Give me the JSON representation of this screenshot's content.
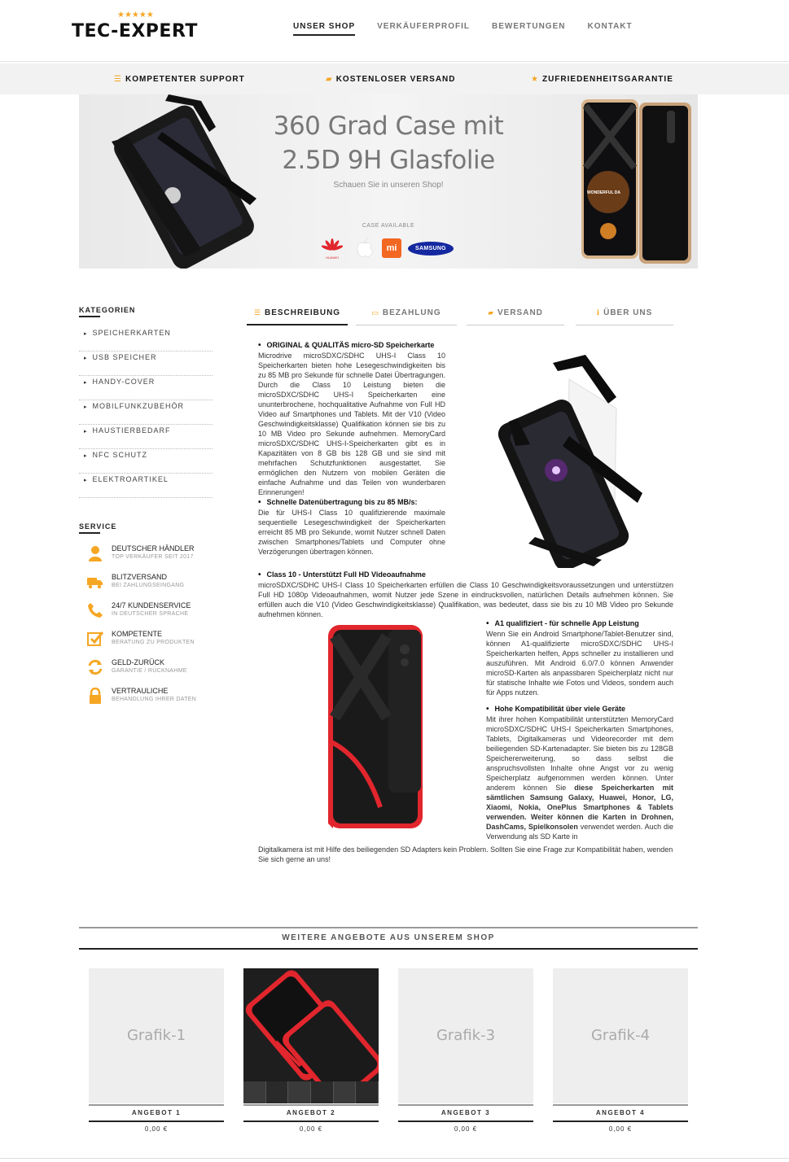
{
  "header": {
    "logo_stars": "★★★★★",
    "logo_text": "TEC-EXPERT",
    "nav": [
      "UNSER SHOP",
      "VERKÄUFERPROFIL",
      "BEWERTUNGEN",
      "KONTAKT"
    ]
  },
  "usp": [
    {
      "icon": "list-icon",
      "glyph": "☰",
      "label": "KOMPETENTER SUPPORT"
    },
    {
      "icon": "truck-icon",
      "glyph": "▰",
      "label": "KOSTENLOSER VERSAND"
    },
    {
      "icon": "star-icon",
      "glyph": "★",
      "label": "ZUFRIEDENHEITSGARANTIE"
    }
  ],
  "banner": {
    "title_line1": "360 Grad Case mit",
    "title_line2": "2.5D 9H Glasfolie",
    "subtitle": "Schauen Sie in unseren Shop!",
    "case_available": "CASE AVAILABLE",
    "brand_huawei": "HUAWEI",
    "brand_mi": "mi",
    "brand_samsung": "SAMSUNG"
  },
  "sidebar": {
    "categories_title": "KATEGORIEN",
    "categories": [
      "SPEICHERKARTEN",
      "USB SPEICHER",
      "HANDY-COVER",
      "MOBILFUNKZUBEHÖR",
      "HAUSTIERBEDARF",
      "NFC SCHUTZ",
      "ELEKTROARTIKEL"
    ],
    "service_title": "SERVICE",
    "services": [
      {
        "icon": "user-icon",
        "title": "DEUTSCHER HÄNDLER",
        "sub": "TOP VERKÄUFER SEIT 2017"
      },
      {
        "icon": "truck-icon",
        "title": "BLITZVERSAND",
        "sub": "BEI ZAHLUNGSEINGANG"
      },
      {
        "icon": "phone-icon",
        "title": "24/7 KUNDENSERVICE",
        "sub": "IN DEUTSCHER SPRACHE"
      },
      {
        "icon": "checkbox-icon",
        "title": "KOMPETENTE",
        "sub": "BERATUNG ZU PRODUKTEN"
      },
      {
        "icon": "refresh-icon",
        "title": "GELD-ZURÜCK",
        "sub": "GARANTIE / RÜCKNAHME"
      },
      {
        "icon": "lock-icon",
        "title": "VERTRAULICHE",
        "sub": "BEHANDLUNG IHRER DATEN"
      }
    ]
  },
  "tabs": [
    {
      "glyph": "☰",
      "label": "BESCHREIBUNG"
    },
    {
      "glyph": "▭",
      "label": "BEZAHLUNG"
    },
    {
      "glyph": "▰",
      "label": "VERSAND"
    },
    {
      "glyph": "ℹ",
      "label": "ÜBER UNS"
    }
  ],
  "description": {
    "h1": "ORIGINAL & QUALITÄS micro-SD Speicherkarte",
    "p1": "Microdrive microSDXC/SDHC UHS-I Class 10 Speicherkarten bieten hohe Lesegeschwindigkeiten bis zu 85 MB pro Sekunde für schnelle Datei Übertragungen. Durch die Class 10 Leistung bieten die microSDXC/SDHC UHS-I Speicherkarten eine ununterbrochene, hochqualitative Aufnahme von Full HD Video auf Smartphones und Tablets. Mit der V10 (Video Geschwindigkeitsklasse) Qualifikation können sie bis zu 10 MB Video pro Sekunde aufnehmen. MemoryCard microSDXC/SDHC UHS-I-Speicherkarten gibt es in Kapazitäten von 8 GB bis 128 GB und sie sind mit mehrfachen Schutzfunktionen ausgestattet. Sie ermöglichen den Nutzern von mobilen Geräten die einfache Aufnahme und das Teilen von wunderbaren Erinnerungen!",
    "h2": "Schnelle Datenübertragung bis zu 85 MB/s:",
    "p2": "Die für UHS-I Class 10 qualifizierende maximale sequentielle Lesegeschwindigkeit der Speicherkarten erreicht 85 MB pro Sekunde, womit Nutzer schnell Daten zwischen Smartphones/Tablets und Computer ohne Verzögerungen übertragen können.",
    "h3": "Class 10 - Unterstützt Full HD Videoaufnahme",
    "p3": "microSDXC/SDHC UHS-I Class 10 Speicherkarten erfüllen die Class 10 Geschwindigkeitsvoraussetzungen und unterstützen Full HD 1080p Videoaufnahmen, womit Nutzer jede Szene in eindrucksvollen, natürlichen Details aufnehmen können. Sie erfüllen auch die V10 (Video Geschwindigkeitsklasse) Qualifikation, was bedeutet, dass sie bis zu 10 MB Video pro Sekunde aufnehmen können.",
    "h4": "A1 qualifiziert - für schnelle App Leistung",
    "p4": "Wenn Sie ein Android Smartphone/Tablet-Benutzer sind, können A1-qualifizierte microSDXC/SDHC UHS-I Speicherkarten helfen, Apps schneller zu installieren und auszuführen. Mit Android 6.0/7.0 können Anwender microSD-Karten als anpassbaren Speicherplatz nicht nur für statische Inhalte wie Fotos und Videos, sondern auch für Apps nutzen.",
    "h5": "Hohe Kompatibilität über viele Geräte",
    "p5a": "Mit ihrer hohen Kompatibilität unterstützten MemoryCard microSDXC/SDHC UHS-I Speicherkarten Smartphones, Tablets, Digitalkameras und Videorecorder mit dem beiliegenden SD-Kartenadapter. Sie bieten bis zu 128GB Speichererweiterung, so dass selbst die anspruchsvollsten Inhalte ohne Angst vor zu wenig Speicherplatz aufgenommen werden können. Unter anderem können Sie",
    "p5b": "diese Speicherkarten mit sämtlichen Samsung Galaxy, Huawei, Honor, LG, Xiaomi, Nokia, OnePlus Smartphones & Tablets verwenden. Weiter können die Karten in Drohnen, DashCams, Spielkonsolen",
    "p5c": "verwendet werden. Auch die Verwendung als SD Karte in",
    "p6": "Digitalkamera ist mit Hilfe des beiliegenden SD Adapters kein Problem. Sollten Sie eine Frage zur Kompatibilität haben, wenden Sie sich gerne an uns!"
  },
  "phone_screen_text": "WONDERFUL DA",
  "more": {
    "title": "WEITERE ANGEBOTE AUS UNSEREM SHOP",
    "offers": [
      {
        "image_label": "Grafik-1",
        "name": "ANGEBOT 1",
        "price": "0,00 €"
      },
      {
        "image_label": "",
        "name": "ANGEBOT 2",
        "price": "0,00 €"
      },
      {
        "image_label": "Grafik-3",
        "name": "ANGEBOT 3",
        "price": "0,00 €"
      },
      {
        "image_label": "Grafik-4",
        "name": "ANGEBOT 4",
        "price": "0,00 €"
      }
    ]
  },
  "colors": {
    "accent": "#f5a623",
    "red_case": "#e1262d",
    "dark": "#222222"
  }
}
